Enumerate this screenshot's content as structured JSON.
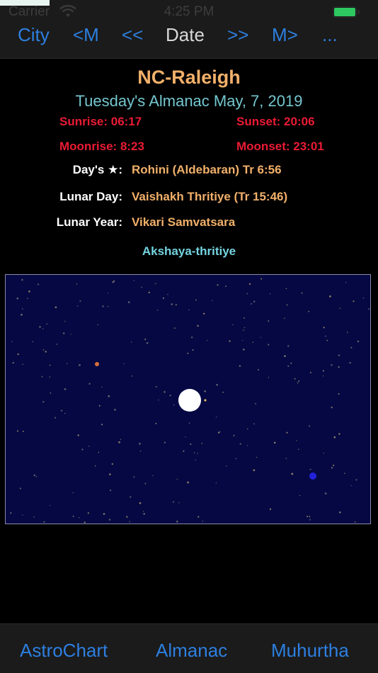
{
  "status_bar": {
    "carrier": "Carrier",
    "time": "4:25 PM",
    "wifi_icon": "wifi-icon",
    "battery_icon": "battery-icon",
    "battery_color": "#2ec860"
  },
  "nav": {
    "city": "City",
    "prev_month": "<M",
    "prev_day": "<<",
    "title": "Date",
    "next_day": ">>",
    "next_month": "M>",
    "more": "..."
  },
  "almanac": {
    "location": "NC-Raleigh",
    "date_line": "Tuesday's Almanac May, 7, 2019",
    "sunrise": "Sunrise: 06:17",
    "sunset": "Sunset: 20:06",
    "moonrise": "Moonrise: 8:23",
    "moonset": "Moonset: 23:01",
    "rows": [
      {
        "label": "Day's ★:",
        "value": "Rohini (Aldebaran) Tr 6:56"
      },
      {
        "label": "Lunar Day:",
        "value": "Vaishakh Thritiye (Tr 15:46)"
      },
      {
        "label": "Lunar Year:",
        "value": "Vikari Samvatsara"
      }
    ],
    "festival": "Akshaya-thritiye"
  },
  "sky_map": {
    "background_color": "#060843",
    "moon_color": "#ffffff",
    "red_planet_color": "#d8703c",
    "blue_planet_color": "#2222dd"
  },
  "tab_bar": {
    "items": [
      "AstroChart",
      "Almanac",
      "Muhurtha"
    ]
  },
  "colors": {
    "accent_blue": "#2d7fe0",
    "orange": "#f2b06a",
    "red": "#ea1b34",
    "teal": "#74c7cf"
  }
}
